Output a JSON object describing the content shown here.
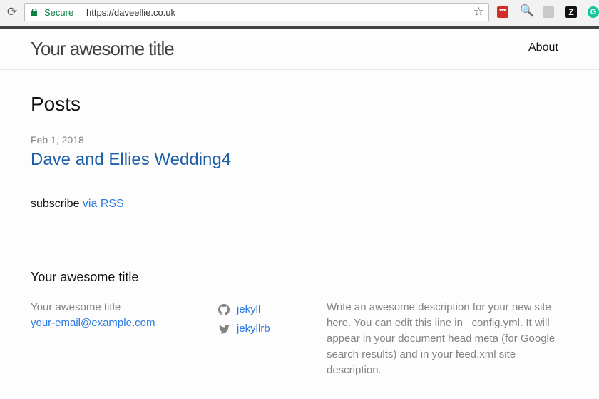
{
  "browser": {
    "security_label": "Secure",
    "url": "https://daveellie.co.uk",
    "reload_glyph": "⟳",
    "star_glyph": "☆",
    "extensions": [
      {
        "name": "lastpass-extension-icon",
        "glyph": "•••"
      },
      {
        "name": "search-extension-icon",
        "glyph": "🔍"
      },
      {
        "name": "camera-extension-icon",
        "glyph": ""
      },
      {
        "name": "zotero-extension-icon",
        "glyph": "Z"
      },
      {
        "name": "grammarly-extension-icon",
        "glyph": "G"
      }
    ]
  },
  "header": {
    "site_title": "Your awesome title",
    "nav": [
      {
        "label": "About"
      }
    ]
  },
  "main": {
    "heading": "Posts",
    "posts": [
      {
        "date": "Feb 1, 2018",
        "title": "Dave and Ellies Wedding4"
      }
    ],
    "rss_prefix": "subscribe ",
    "rss_link": "via RSS"
  },
  "footer": {
    "heading": "Your awesome title",
    "name": "Your awesome title",
    "email": "your-email@example.com",
    "social": [
      {
        "icon": "github-icon",
        "label": "jekyll"
      },
      {
        "icon": "twitter-icon",
        "label": "jekyllrb"
      }
    ],
    "description": "Write an awesome description for your new site here. You can edit this line in _config.yml. It will appear in your document head meta (for Google search results) and in your feed.xml site description."
  },
  "colors": {
    "link": "#2a7ae2",
    "secure": "#0b8043",
    "muted": "#828282"
  }
}
